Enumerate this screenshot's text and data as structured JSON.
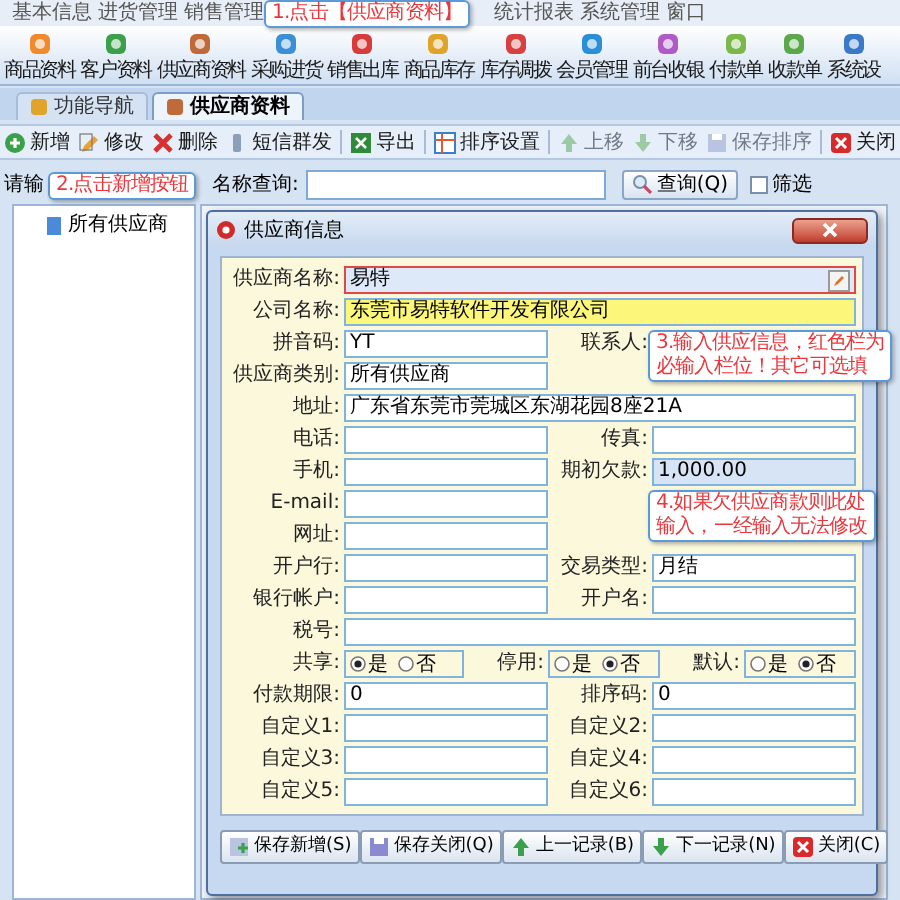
{
  "menu": [
    {
      "label": "基本信息"
    },
    {
      "label": "进货管理"
    },
    {
      "label": "销售管理"
    },
    {
      "label": "统计报表"
    },
    {
      "label": "系统管理"
    },
    {
      "label": "窗口"
    }
  ],
  "toolbar": [
    {
      "label": "商品资料"
    },
    {
      "label": "客户资料"
    },
    {
      "label": "供应商资料"
    },
    {
      "label": "采购进货"
    },
    {
      "label": "销售出库"
    },
    {
      "label": "商品库存"
    },
    {
      "label": "库存调拨"
    },
    {
      "label": "会员管理"
    },
    {
      "label": "前台收银"
    },
    {
      "label": "付款单"
    },
    {
      "label": "收款单"
    },
    {
      "label": "系统设"
    }
  ],
  "tabs": [
    {
      "label": "功能导航",
      "selected": false
    },
    {
      "label": "供应商资料",
      "selected": true
    }
  ],
  "actions": [
    {
      "label": "新增",
      "disabled": false
    },
    {
      "label": "修改",
      "disabled": false
    },
    {
      "label": "删除",
      "disabled": false
    },
    {
      "label": "短信群发",
      "disabled": false
    },
    {
      "label": "导出",
      "disabled": false
    },
    {
      "label": "排序设置",
      "disabled": false
    },
    {
      "label": "上移",
      "disabled": true
    },
    {
      "label": "下移",
      "disabled": true
    },
    {
      "label": "保存排序",
      "disabled": true
    },
    {
      "label": "关闭",
      "disabled": false
    }
  ],
  "search": {
    "label_start": "请输",
    "label_end": "名称查询:",
    "button": "查询(Q)",
    "filter": {
      "label": "筛选",
      "checked": false
    }
  },
  "tree": [
    {
      "label": "所有供应商"
    }
  ],
  "dialog": {
    "title": "供应商信息",
    "rows": [
      {
        "kind": "full",
        "fields": [
          {
            "label": "供应商名称:",
            "value": "易特",
            "kind": "required"
          }
        ]
      },
      {
        "kind": "full",
        "fields": [
          {
            "label": "公司名称:",
            "value": "东莞市易特软件开发有限公司",
            "kind": "highlight"
          }
        ]
      },
      {
        "kind": "pair",
        "fields": [
          {
            "label": "拼音码:",
            "value": "YT"
          },
          {
            "label": "联系人:",
            "kind": "label"
          }
        ]
      },
      {
        "kind": "pair",
        "fields": [
          {
            "label": "供应商类别:",
            "value": "所有供应商"
          }
        ]
      },
      {
        "kind": "full",
        "fields": [
          {
            "label": "地址:",
            "value": "广东省东莞市莞城区东湖花园8座21A"
          }
        ]
      },
      {
        "kind": "pair",
        "fields": [
          {
            "label": "电话:"
          },
          {
            "label": "传真:"
          }
        ]
      },
      {
        "kind": "pair",
        "fields": [
          {
            "label": "手机:"
          },
          {
            "label": "期初欠款:",
            "value": "1,000.00",
            "kind": "info"
          }
        ]
      },
      {
        "kind": "pair",
        "fields": [
          {
            "label": "E-mail:"
          }
        ]
      },
      {
        "kind": "pair",
        "fields": [
          {
            "label": "网址:"
          }
        ]
      },
      {
        "kind": "pair",
        "fields": [
          {
            "label": "开户行:"
          },
          {
            "label": "交易类型:",
            "value": "月结"
          }
        ]
      },
      {
        "kind": "pair",
        "fields": [
          {
            "label": "银行帐户:"
          },
          {
            "label": "开户名:"
          }
        ]
      },
      {
        "kind": "full",
        "fields": [
          {
            "label": "税号:"
          }
        ]
      },
      {
        "kind": "radios",
        "groups": [
          {
            "label": "共享:",
            "options": [
              {
                "label": "是",
                "selected": true
              },
              {
                "label": "否",
                "selected": false
              }
            ]
          },
          {
            "label": "停用:",
            "options": [
              {
                "label": "是",
                "selected": false
              },
              {
                "label": "否",
                "selected": true
              }
            ]
          },
          {
            "label": "默认:",
            "options": [
              {
                "label": "是",
                "selected": false
              },
              {
                "label": "否",
                "selected": true
              }
            ]
          }
        ]
      },
      {
        "kind": "pair",
        "fields": [
          {
            "label": "付款期限:",
            "value": "0"
          },
          {
            "label": "排序码:",
            "value": "0"
          }
        ]
      },
      {
        "kind": "pair",
        "fields": [
          {
            "label": "自定义1:"
          },
          {
            "label": "自定义2:"
          }
        ]
      },
      {
        "kind": "pair",
        "fields": [
          {
            "label": "自定义3:"
          },
          {
            "label": "自定义4:"
          }
        ]
      },
      {
        "kind": "pair",
        "fields": [
          {
            "label": "自定义5:"
          },
          {
            "label": "自定义6:"
          }
        ]
      }
    ],
    "buttons": [
      {
        "label": "保存新增(S)"
      },
      {
        "label": "保存关闭(Q)"
      },
      {
        "label": "上一记录(B)"
      },
      {
        "label": "下一记录(N)"
      },
      {
        "label": "关闭(C)"
      }
    ]
  },
  "callouts": [
    {
      "lines": [
        "1.点击【供应商资料】"
      ]
    },
    {
      "lines": [
        "2.点击新增按钮"
      ]
    },
    {
      "lines": [
        "3.输入供应信息，红色栏为",
        "必输入栏位！其它可选填"
      ]
    },
    {
      "lines": [
        "4.如果欠供应商款则此处",
        "输入，一经输入无法修改"
      ]
    }
  ]
}
